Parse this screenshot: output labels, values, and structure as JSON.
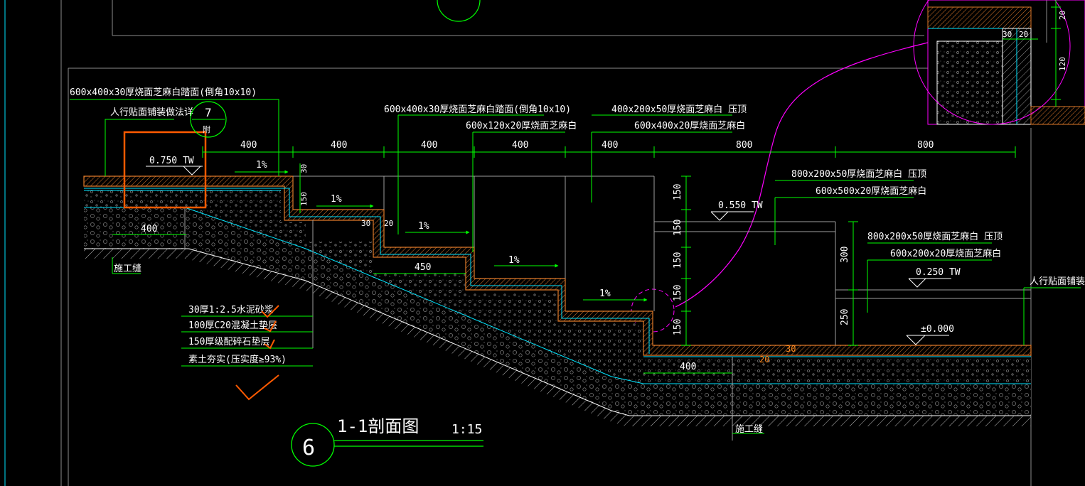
{
  "drawing": {
    "title": "1-1剖面图",
    "scale": "1:15",
    "detail_number": "6",
    "colors": {
      "background": "#000000",
      "dimension": "#00ff00",
      "outline": "#ffffff",
      "paving": "#ff8a1f",
      "base_line": "#00e5ff",
      "detail_circle": "#ff00ff",
      "markup": "#ff5a00",
      "grey": "#8c8c8c"
    }
  },
  "labels": {
    "top_paving": "600x400x30厚烧面芝麻白踏面(倒角10x10)",
    "sidewalk_ref": "人行贴面铺装做法详",
    "ref_bubble_num": "7",
    "ref_bubble_sub": "附",
    "tread_paving": "600x400x30厚烧面芝麻白踏面(倒角10x10)",
    "riser_paving": "600x120x20厚烧面芝麻白",
    "coping_1": "400x200x50厚烧面芝麻白 压顶",
    "wall_face_1": "600x400x20厚烧面芝麻白",
    "coping_2": "800x200x50厚烧面芝麻白 压顶",
    "wall_face_2": "600x500x20厚烧面芝麻白",
    "coping_3": "800x200x50厚烧面芝麻白 压顶",
    "wall_face_3": "600x200x20厚烧面芝麻白",
    "sidewalk_ref_right": "人行贴面铺装做法",
    "joint_left": "施工缝",
    "joint_right": "施工缝"
  },
  "layers": [
    "30厚1:2.5水泥砂浆",
    "100厚C20混凝土垫层",
    "150厚级配碎石垫层",
    "素土夯实(压实度≥93%)"
  ],
  "levels": {
    "top": "0.750 TW",
    "wall_1": "0.550 TW",
    "wall_2": "0.250 TW",
    "ground": "±0.000"
  },
  "slopes": [
    "1%",
    "1%",
    "1%",
    "1%",
    "1%"
  ],
  "dimensions": {
    "top_run": [
      "400",
      "400",
      "400",
      "400",
      "400",
      "800",
      "800"
    ],
    "vertical_stack": [
      "150",
      "150",
      "150",
      "150",
      "150"
    ],
    "wall_right": [
      "300",
      "250"
    ],
    "step_side": "150",
    "top_side": "30",
    "tread_a": "30",
    "tread_b": "20",
    "base_left": "400",
    "step_base": "450",
    "base_bottom": "400",
    "inset_h": [
      "30",
      "20"
    ],
    "inset_v": [
      "20",
      "120"
    ],
    "paving_thk_a": "30",
    "paving_thk_b": "20"
  }
}
